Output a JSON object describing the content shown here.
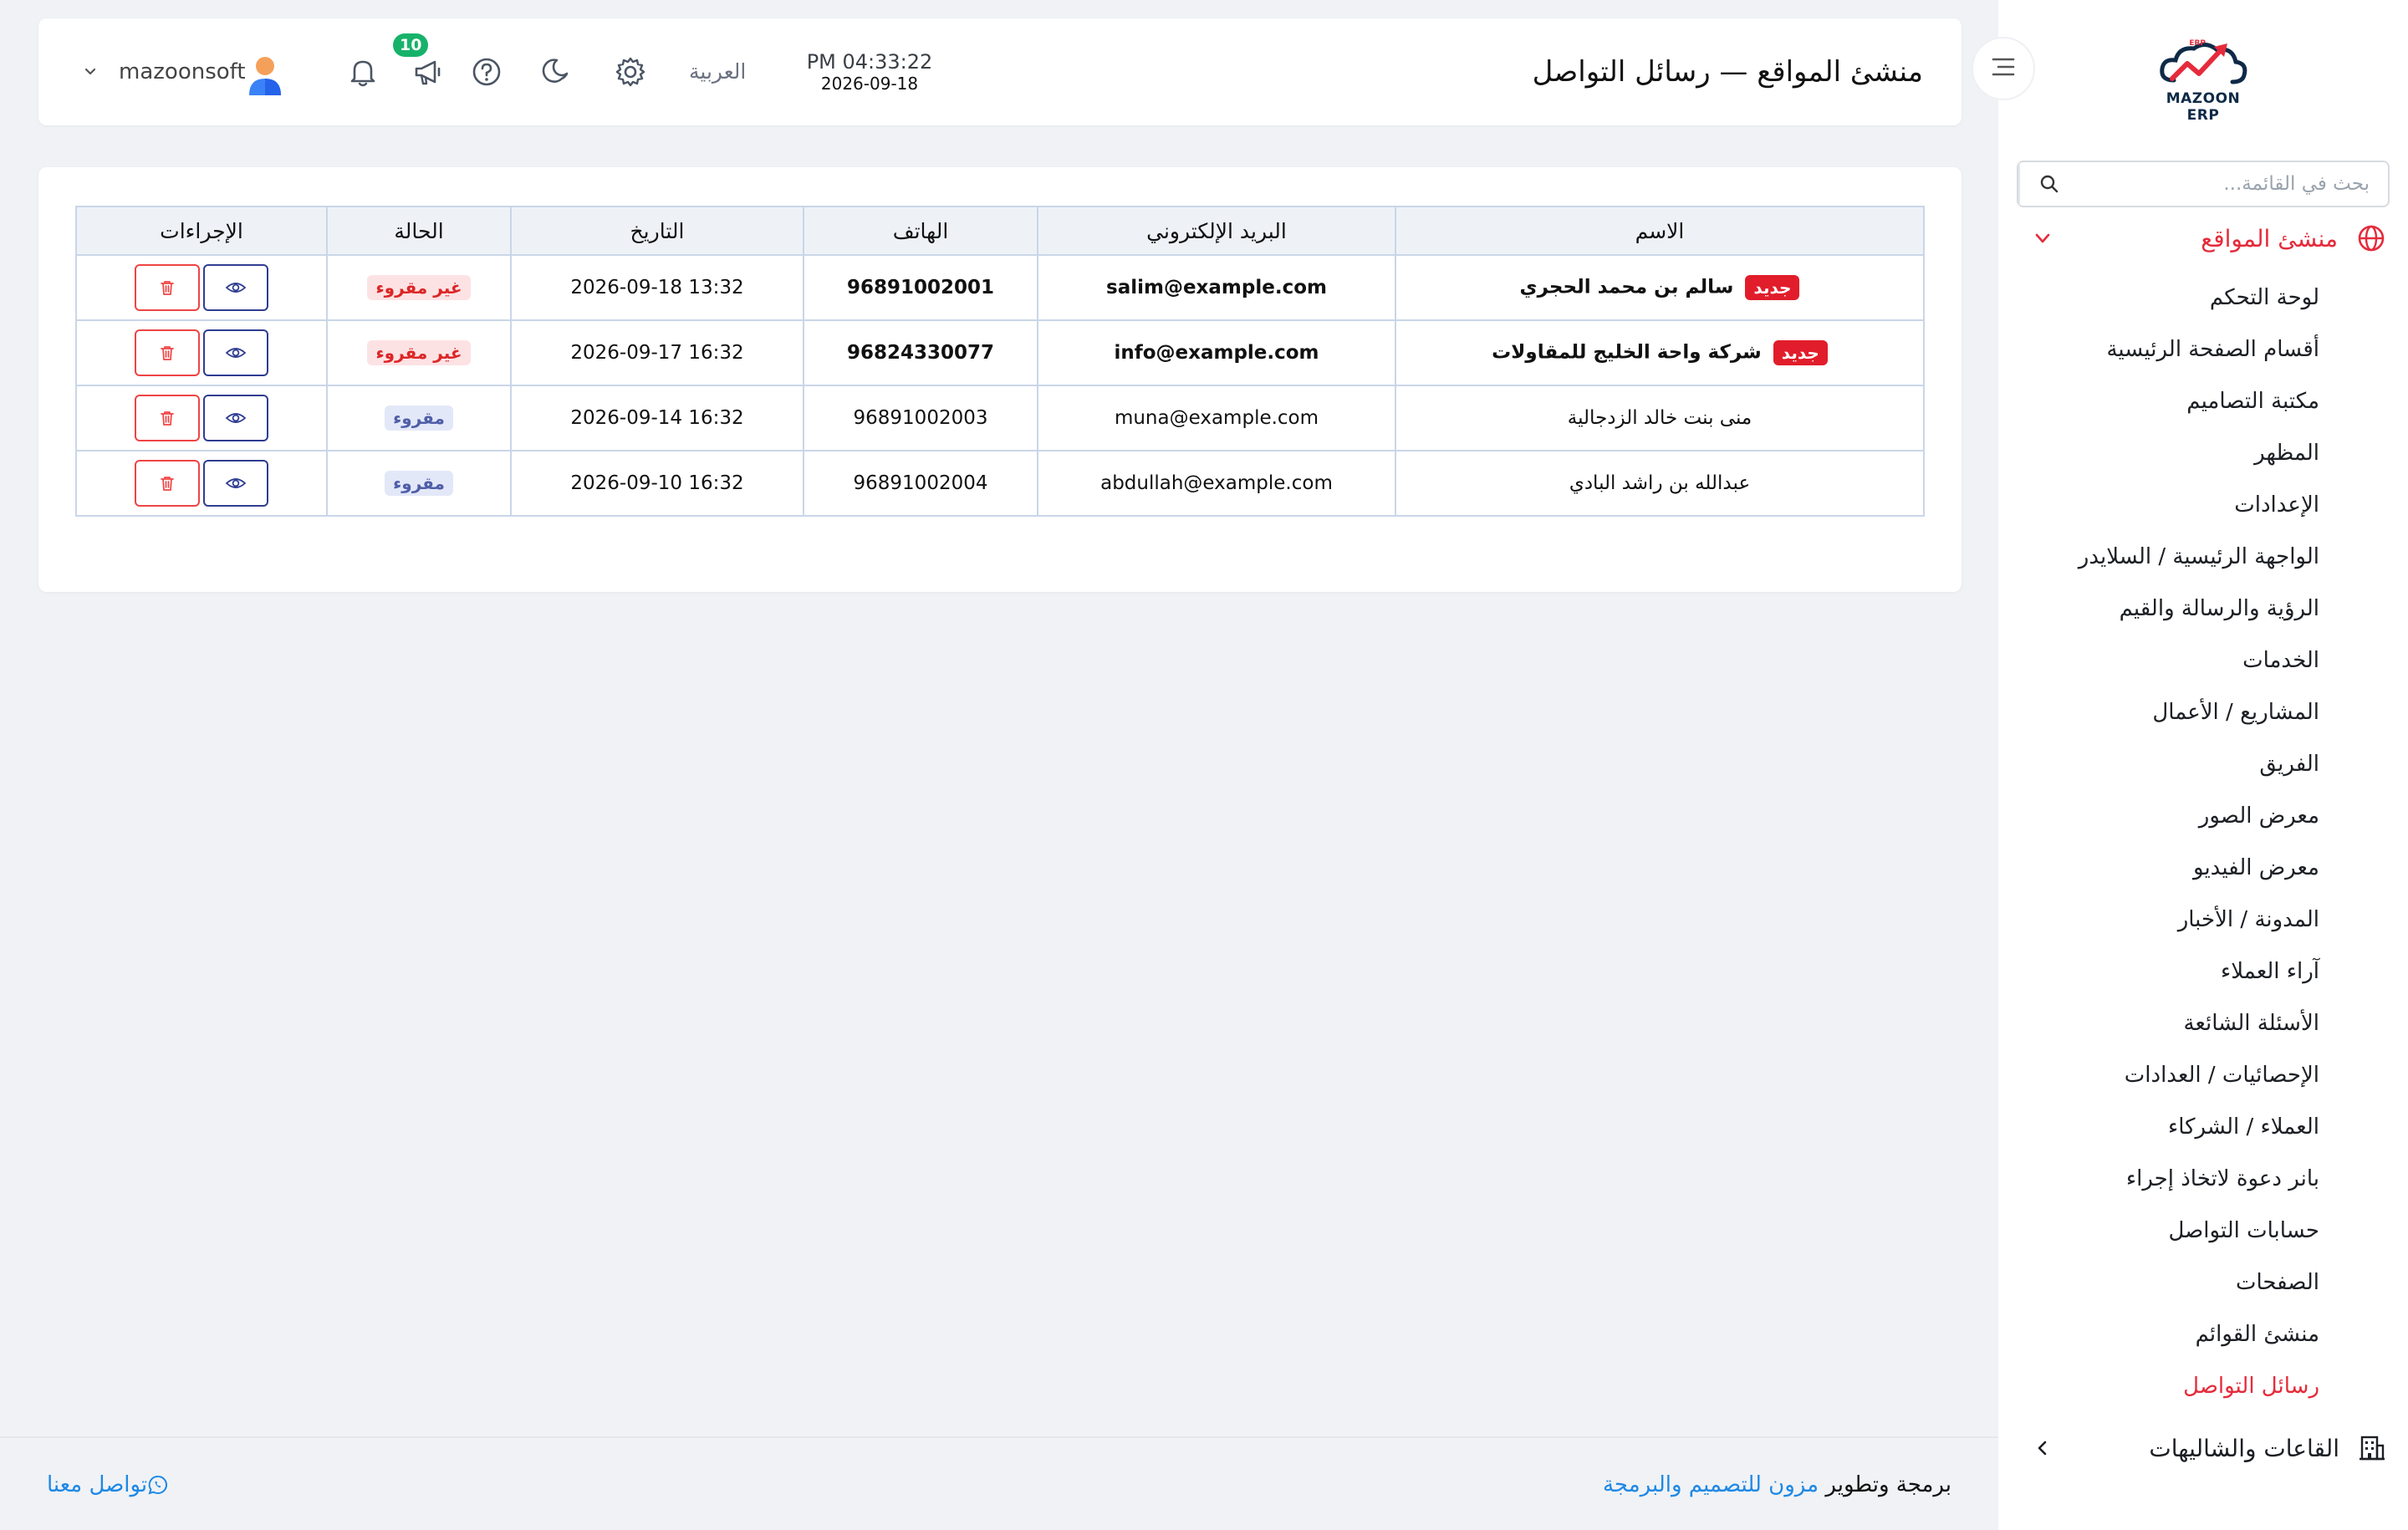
{
  "brand": {
    "logo_text": "MAZOON ERP"
  },
  "sidebar": {
    "search_placeholder": "بحث في القائمة...",
    "section": {
      "label": "منشئ المواقع"
    },
    "items": [
      {
        "label": "لوحة التحكم"
      },
      {
        "label": "أقسام الصفحة الرئيسية"
      },
      {
        "label": "مكتبة التصاميم"
      },
      {
        "label": "المظهر"
      },
      {
        "label": "الإعدادات"
      },
      {
        "label": "الواجهة الرئيسية / السلايدر"
      },
      {
        "label": "الرؤية والرسالة والقيم"
      },
      {
        "label": "الخدمات"
      },
      {
        "label": "المشاريع / الأعمال"
      },
      {
        "label": "الفريق"
      },
      {
        "label": "معرض الصور"
      },
      {
        "label": "معرض الفيديو"
      },
      {
        "label": "المدونة / الأخبار"
      },
      {
        "label": "آراء العملاء"
      },
      {
        "label": "الأسئلة الشائعة"
      },
      {
        "label": "الإحصائيات / العدادات"
      },
      {
        "label": "العملاء / الشركاء"
      },
      {
        "label": "بانر دعوة لاتخاذ إجراء"
      },
      {
        "label": "حسابات التواصل"
      },
      {
        "label": "الصفحات"
      },
      {
        "label": "منشئ القوائم"
      },
      {
        "label": "رسائل التواصل",
        "active": true
      }
    ],
    "section2": {
      "label": "القاعات والشاليهات"
    }
  },
  "header": {
    "title": "منشئ المواقع — رسائل التواصل",
    "time": "PM 04:33:22",
    "date": "2026-09-18",
    "language": "العربية",
    "notification_count": "10",
    "username": "mazoonsoft"
  },
  "table": {
    "columns": [
      "الاسم",
      "البريد الإلكتروني",
      "الهاتف",
      "التاريخ",
      "الحالة",
      "الإجراءات"
    ],
    "new_tag": "جديد",
    "rows": [
      {
        "name": "سالم بن محمد الحجري",
        "email": "salim@example.com",
        "phone": "96891002001",
        "date": "2026-09-18 13:32",
        "status": "غير مقروء",
        "is_new": true
      },
      {
        "name": "شركة واحة الخليج للمقاولات",
        "email": "info@example.com",
        "phone": "96824330077",
        "date": "2026-09-17 16:32",
        "status": "غير مقروء",
        "is_new": true
      },
      {
        "name": "منى بنت خالد الزدجالية",
        "email": "muna@example.com",
        "phone": "96891002003",
        "date": "2026-09-14 16:32",
        "status": "مقروء",
        "is_new": false
      },
      {
        "name": "عبدالله بن راشد البادي",
        "email": "abdullah@example.com",
        "phone": "96891002004",
        "date": "2026-09-10 16:32",
        "status": "مقروء",
        "is_new": false
      }
    ]
  },
  "footer": {
    "credit_prefix": "برمجة وتطوير",
    "credit_link": "مزون للتصميم والبرمجة",
    "contact": "تواصل معنا"
  },
  "colors": {
    "accent_red": "#e52b3b",
    "new_badge": "#e11d2b",
    "notify_badge": "#17b26a",
    "link_blue": "#1e88e5",
    "view_btn": "#2f3d91"
  }
}
